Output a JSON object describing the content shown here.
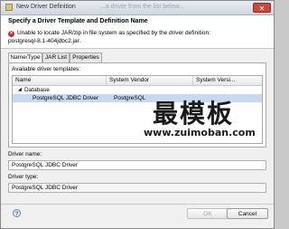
{
  "window": {
    "title": "New Driver Definition",
    "title_ghost": "...a driver from the list below..."
  },
  "header": {
    "title": "Specify a Driver Template and Definition Name",
    "error_line1": "Unable to locate JAR/zip in file system as specified by the driver definition:",
    "error_line2": "postgresql-8.1-404jdbc2.jar."
  },
  "tabs": [
    {
      "label": "Name/Type",
      "active": true
    },
    {
      "label": "JAR List",
      "active": false
    },
    {
      "label": "Properties",
      "active": false
    }
  ],
  "templates": {
    "label": "Available driver templates:",
    "columns": [
      "Name",
      "System Vendor",
      "System Versi..."
    ],
    "group": "Database",
    "selected_row": {
      "name": "PostgreSQL JDBC Driver",
      "vendor": "PostgreSQL",
      "version": ""
    }
  },
  "driver_name": {
    "label": "Driver name:",
    "value": "PostgreSQL JDBC Driver"
  },
  "driver_type": {
    "label": "Driver type:",
    "value": "PostgreSQL JDBC Driver"
  },
  "buttons": {
    "help": "?",
    "ok": "OK",
    "cancel": "Cancel"
  },
  "watermark": {
    "line1": "最模板",
    "line2": "www.zuimoban.com"
  },
  "colors": {
    "selection": "#c7d9ee",
    "error": "#d12c2c"
  }
}
